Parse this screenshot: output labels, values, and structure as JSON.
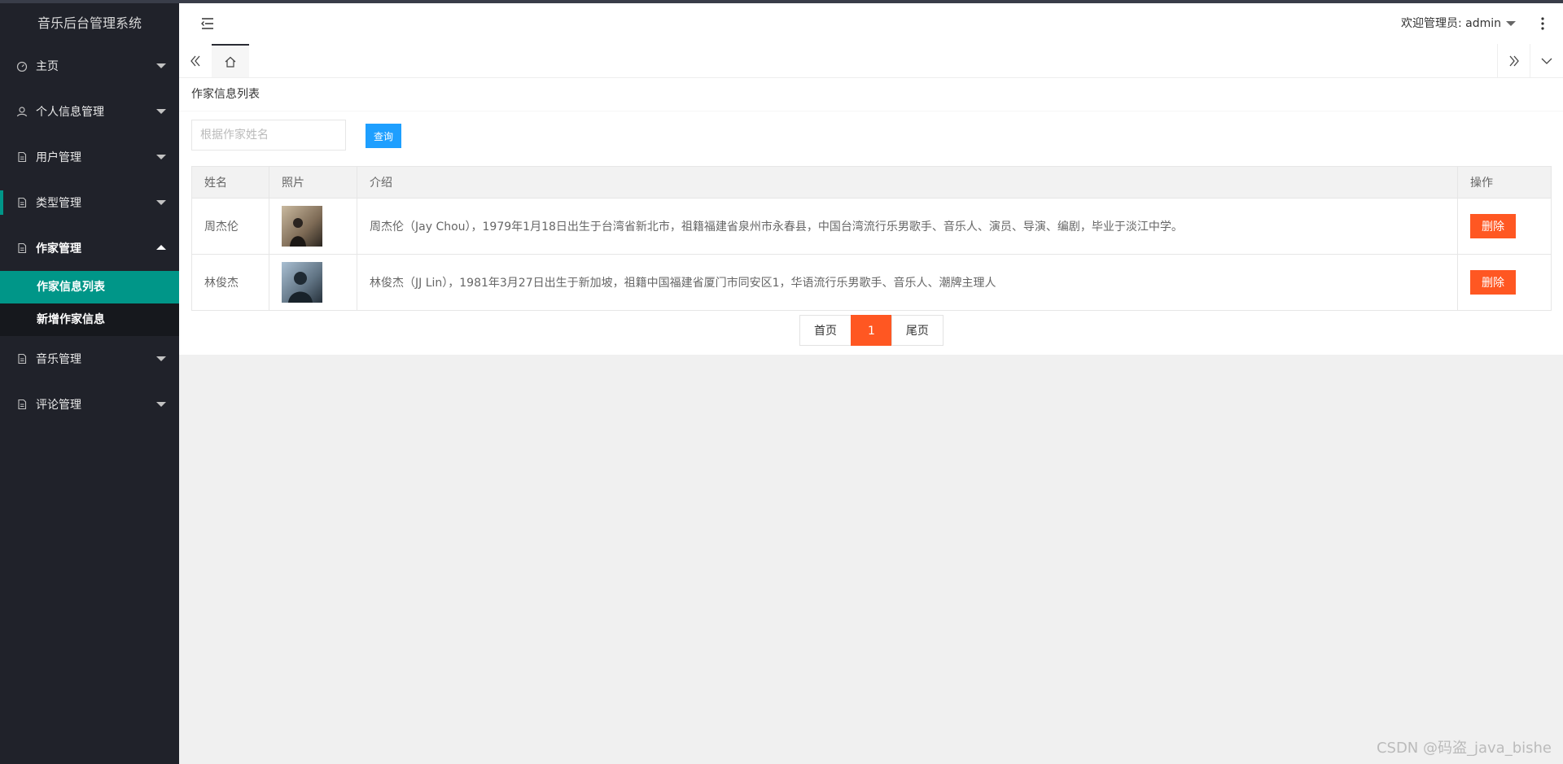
{
  "app": {
    "title": "音乐后台管理系统"
  },
  "sidebar": {
    "items": [
      {
        "label": "主页",
        "icon": "dashboard-icon"
      },
      {
        "label": "个人信息管理",
        "icon": "user-icon"
      },
      {
        "label": "用户管理",
        "icon": "file-icon"
      },
      {
        "label": "类型管理",
        "icon": "file-icon"
      },
      {
        "label": "作家管理",
        "icon": "file-icon",
        "expanded": true,
        "children": [
          {
            "label": "作家信息列表",
            "active": true
          },
          {
            "label": "新增作家信息"
          }
        ]
      },
      {
        "label": "音乐管理",
        "icon": "file-icon"
      },
      {
        "label": "评论管理",
        "icon": "file-icon"
      }
    ]
  },
  "header": {
    "user_text": "欢迎管理员: admin"
  },
  "page": {
    "title": "作家信息列表",
    "search": {
      "placeholder": "根据作家姓名",
      "value": "",
      "button": "查询"
    }
  },
  "table": {
    "columns": [
      "姓名",
      "照片",
      "介绍",
      "操作"
    ],
    "rows": [
      {
        "name": "周杰伦",
        "intro": "周杰伦（Jay Chou），1979年1月18日出生于台湾省新北市，祖籍福建省泉州市永春县，中国台湾流行乐男歌手、音乐人、演员、导演、编剧，毕业于淡江中学。",
        "action": "删除"
      },
      {
        "name": "林俊杰",
        "intro": "林俊杰（JJ Lin），1981年3月27日出生于新加坡，祖籍中国福建省厦门市同安区1，华语流行乐男歌手、音乐人、潮牌主理人",
        "action": "删除"
      }
    ]
  },
  "pagination": {
    "first": "首页",
    "current": "1",
    "last": "尾页"
  },
  "watermark": "CSDN @码盗_java_bishe",
  "colors": {
    "sidebar": "#20222a",
    "active": "#009688",
    "primary": "#1e9fff",
    "danger": "#ff5722"
  }
}
